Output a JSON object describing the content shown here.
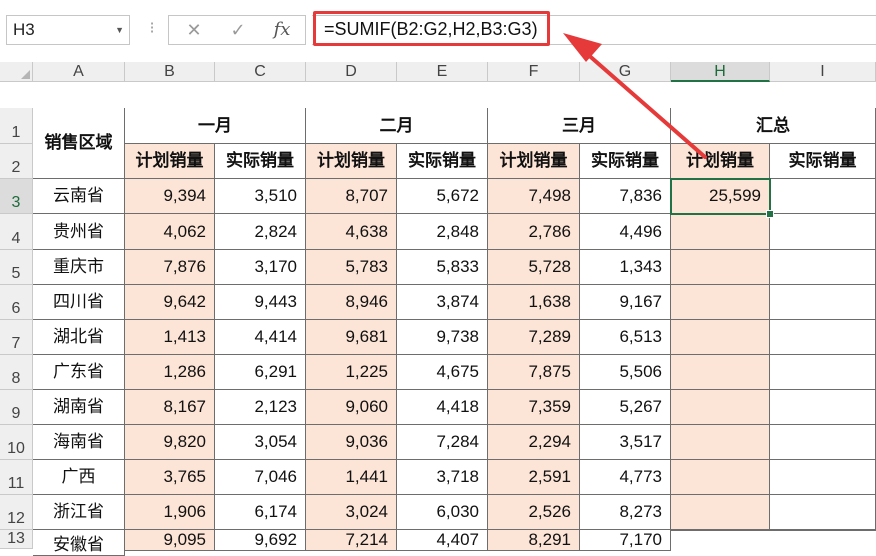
{
  "formula_bar": {
    "name_box": "H3",
    "formula": "=SUMIF(B2:G2,H2,B3:G3)",
    "cancel_icon": "✕",
    "enter_icon": "✓",
    "fx_icon": "fx"
  },
  "columns": [
    "A",
    "B",
    "C",
    "D",
    "E",
    "F",
    "G",
    "H",
    "I"
  ],
  "rows": [
    "1",
    "2",
    "3",
    "4",
    "5",
    "6",
    "7",
    "8",
    "9",
    "10",
    "11",
    "12",
    "13"
  ],
  "header": {
    "region_label": "销售区域",
    "months": [
      "一月",
      "二月",
      "三月"
    ],
    "summary_label": "汇总",
    "plan_label": "计划销量",
    "actual_label": "实际销量"
  },
  "data": [
    {
      "region": "云南省",
      "values": [
        "9,394",
        "3,510",
        "8,707",
        "5,672",
        "7,498",
        "7,836"
      ],
      "h": "25,599",
      "i": ""
    },
    {
      "region": "贵州省",
      "values": [
        "4,062",
        "2,824",
        "4,638",
        "2,848",
        "2,786",
        "4,496"
      ],
      "h": "",
      "i": ""
    },
    {
      "region": "重庆市",
      "values": [
        "7,876",
        "3,170",
        "5,783",
        "5,833",
        "5,728",
        "1,343"
      ],
      "h": "",
      "i": ""
    },
    {
      "region": "四川省",
      "values": [
        "9,642",
        "9,443",
        "8,946",
        "3,874",
        "1,638",
        "9,167"
      ],
      "h": "",
      "i": ""
    },
    {
      "region": "湖北省",
      "values": [
        "1,413",
        "4,414",
        "9,681",
        "9,738",
        "7,289",
        "6,513"
      ],
      "h": "",
      "i": ""
    },
    {
      "region": "广东省",
      "values": [
        "1,286",
        "6,291",
        "1,225",
        "4,675",
        "7,875",
        "5,506"
      ],
      "h": "",
      "i": ""
    },
    {
      "region": "湖南省",
      "values": [
        "8,167",
        "2,123",
        "9,060",
        "4,418",
        "7,359",
        "5,267"
      ],
      "h": "",
      "i": ""
    },
    {
      "region": "海南省",
      "values": [
        "9,820",
        "3,054",
        "9,036",
        "7,284",
        "2,294",
        "3,517"
      ],
      "h": "",
      "i": ""
    },
    {
      "region": "广西",
      "values": [
        "3,765",
        "7,046",
        "1,441",
        "3,718",
        "2,591",
        "4,773"
      ],
      "h": "",
      "i": ""
    },
    {
      "region": "浙江省",
      "values": [
        "1,906",
        "6,174",
        "3,024",
        "6,030",
        "2,526",
        "8,273"
      ],
      "h": "",
      "i": ""
    },
    {
      "region": "安徽省",
      "values": [
        "9,095",
        "9,692",
        "7,214",
        "4,407",
        "8,291",
        "7,170"
      ],
      "h": "",
      "i": ""
    }
  ],
  "colors": {
    "plan_fill": "#fce4d6",
    "selection": "#217346",
    "annotation": "#e5393a"
  }
}
